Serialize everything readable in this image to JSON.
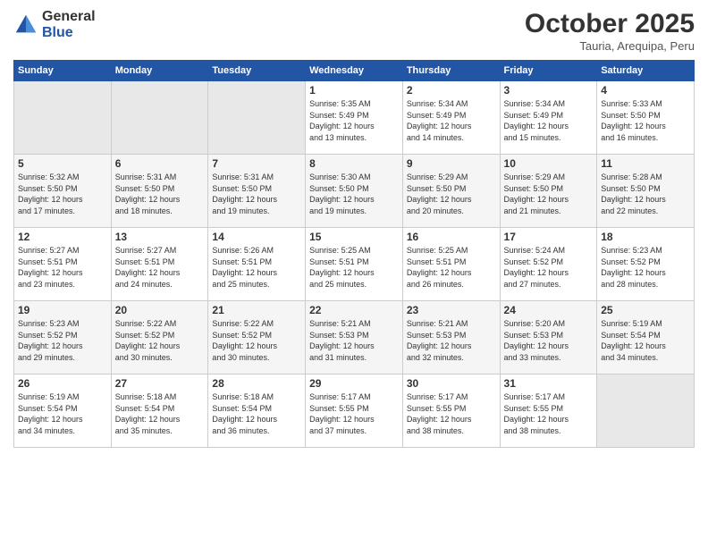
{
  "logo": {
    "general": "General",
    "blue": "Blue"
  },
  "title": "October 2025",
  "location": "Tauria, Arequipa, Peru",
  "weekdays": [
    "Sunday",
    "Monday",
    "Tuesday",
    "Wednesday",
    "Thursday",
    "Friday",
    "Saturday"
  ],
  "weeks": [
    [
      {
        "day": "",
        "info": ""
      },
      {
        "day": "",
        "info": ""
      },
      {
        "day": "",
        "info": ""
      },
      {
        "day": "1",
        "info": "Sunrise: 5:35 AM\nSunset: 5:49 PM\nDaylight: 12 hours\nand 13 minutes."
      },
      {
        "day": "2",
        "info": "Sunrise: 5:34 AM\nSunset: 5:49 PM\nDaylight: 12 hours\nand 14 minutes."
      },
      {
        "day": "3",
        "info": "Sunrise: 5:34 AM\nSunset: 5:49 PM\nDaylight: 12 hours\nand 15 minutes."
      },
      {
        "day": "4",
        "info": "Sunrise: 5:33 AM\nSunset: 5:50 PM\nDaylight: 12 hours\nand 16 minutes."
      }
    ],
    [
      {
        "day": "5",
        "info": "Sunrise: 5:32 AM\nSunset: 5:50 PM\nDaylight: 12 hours\nand 17 minutes."
      },
      {
        "day": "6",
        "info": "Sunrise: 5:31 AM\nSunset: 5:50 PM\nDaylight: 12 hours\nand 18 minutes."
      },
      {
        "day": "7",
        "info": "Sunrise: 5:31 AM\nSunset: 5:50 PM\nDaylight: 12 hours\nand 19 minutes."
      },
      {
        "day": "8",
        "info": "Sunrise: 5:30 AM\nSunset: 5:50 PM\nDaylight: 12 hours\nand 19 minutes."
      },
      {
        "day": "9",
        "info": "Sunrise: 5:29 AM\nSunset: 5:50 PM\nDaylight: 12 hours\nand 20 minutes."
      },
      {
        "day": "10",
        "info": "Sunrise: 5:29 AM\nSunset: 5:50 PM\nDaylight: 12 hours\nand 21 minutes."
      },
      {
        "day": "11",
        "info": "Sunrise: 5:28 AM\nSunset: 5:50 PM\nDaylight: 12 hours\nand 22 minutes."
      }
    ],
    [
      {
        "day": "12",
        "info": "Sunrise: 5:27 AM\nSunset: 5:51 PM\nDaylight: 12 hours\nand 23 minutes."
      },
      {
        "day": "13",
        "info": "Sunrise: 5:27 AM\nSunset: 5:51 PM\nDaylight: 12 hours\nand 24 minutes."
      },
      {
        "day": "14",
        "info": "Sunrise: 5:26 AM\nSunset: 5:51 PM\nDaylight: 12 hours\nand 25 minutes."
      },
      {
        "day": "15",
        "info": "Sunrise: 5:25 AM\nSunset: 5:51 PM\nDaylight: 12 hours\nand 25 minutes."
      },
      {
        "day": "16",
        "info": "Sunrise: 5:25 AM\nSunset: 5:51 PM\nDaylight: 12 hours\nand 26 minutes."
      },
      {
        "day": "17",
        "info": "Sunrise: 5:24 AM\nSunset: 5:52 PM\nDaylight: 12 hours\nand 27 minutes."
      },
      {
        "day": "18",
        "info": "Sunrise: 5:23 AM\nSunset: 5:52 PM\nDaylight: 12 hours\nand 28 minutes."
      }
    ],
    [
      {
        "day": "19",
        "info": "Sunrise: 5:23 AM\nSunset: 5:52 PM\nDaylight: 12 hours\nand 29 minutes."
      },
      {
        "day": "20",
        "info": "Sunrise: 5:22 AM\nSunset: 5:52 PM\nDaylight: 12 hours\nand 30 minutes."
      },
      {
        "day": "21",
        "info": "Sunrise: 5:22 AM\nSunset: 5:52 PM\nDaylight: 12 hours\nand 30 minutes."
      },
      {
        "day": "22",
        "info": "Sunrise: 5:21 AM\nSunset: 5:53 PM\nDaylight: 12 hours\nand 31 minutes."
      },
      {
        "day": "23",
        "info": "Sunrise: 5:21 AM\nSunset: 5:53 PM\nDaylight: 12 hours\nand 32 minutes."
      },
      {
        "day": "24",
        "info": "Sunrise: 5:20 AM\nSunset: 5:53 PM\nDaylight: 12 hours\nand 33 minutes."
      },
      {
        "day": "25",
        "info": "Sunrise: 5:19 AM\nSunset: 5:54 PM\nDaylight: 12 hours\nand 34 minutes."
      }
    ],
    [
      {
        "day": "26",
        "info": "Sunrise: 5:19 AM\nSunset: 5:54 PM\nDaylight: 12 hours\nand 34 minutes."
      },
      {
        "day": "27",
        "info": "Sunrise: 5:18 AM\nSunset: 5:54 PM\nDaylight: 12 hours\nand 35 minutes."
      },
      {
        "day": "28",
        "info": "Sunrise: 5:18 AM\nSunset: 5:54 PM\nDaylight: 12 hours\nand 36 minutes."
      },
      {
        "day": "29",
        "info": "Sunrise: 5:17 AM\nSunset: 5:55 PM\nDaylight: 12 hours\nand 37 minutes."
      },
      {
        "day": "30",
        "info": "Sunrise: 5:17 AM\nSunset: 5:55 PM\nDaylight: 12 hours\nand 38 minutes."
      },
      {
        "day": "31",
        "info": "Sunrise: 5:17 AM\nSunset: 5:55 PM\nDaylight: 12 hours\nand 38 minutes."
      },
      {
        "day": "",
        "info": ""
      }
    ]
  ]
}
